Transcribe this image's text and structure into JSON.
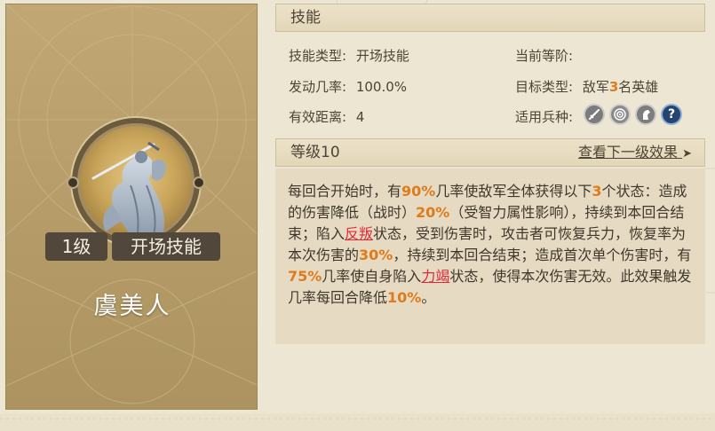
{
  "hero": {
    "level_badge": "1级",
    "skill_type_badge": "开场技能",
    "name": "虞美人"
  },
  "skill_header": "技能",
  "info": {
    "type_label": "技能类型:",
    "type_value": "开场技能",
    "rank_label": "当前等阶:",
    "rank_value": "",
    "rate_label": "发动几率:",
    "rate_value": "100.0%",
    "target_label": "目标类型:",
    "target_prefix": "敌军",
    "target_count": "3",
    "target_suffix": "名英雄",
    "range_label": "有效距离:",
    "range_value": "4",
    "troops_label": "适用兵种:",
    "troop_icons": [
      "sword-icon",
      "bow-target-icon",
      "horse-icon",
      "question-icon"
    ]
  },
  "level_header": {
    "label": "等级10",
    "next_link": "查看下一级效果",
    "arrow": "➤"
  },
  "description": {
    "s1": "每回合开始时，有",
    "p1": "90%",
    "s2": "几率使敌军全体获得以下",
    "p2": "3",
    "s3": "个状态：造成的伤害降低（战时）",
    "p3": "20%",
    "s4": "（受智力属性影响），持续到本回合结束；陷入",
    "k1": "反叛",
    "s5": "状态，受到伤害时，攻击者可恢复兵力，恢复率为本次伤害的",
    "p4": "30%",
    "s6": "，持续到本回合结束；造成首次单个伤害时，有",
    "p5": "75%",
    "s7": "几率使自身陷入",
    "k2": "力竭",
    "s8": "状态，使得本次伤害无效。此效果触发几率每回合降低",
    "p6": "10%",
    "s9": "。"
  },
  "colors": {
    "highlight": "#e07b1b",
    "keyword": "#e0283b",
    "card_bg": "#b9a06c",
    "page_bg": "#ede6d3"
  }
}
